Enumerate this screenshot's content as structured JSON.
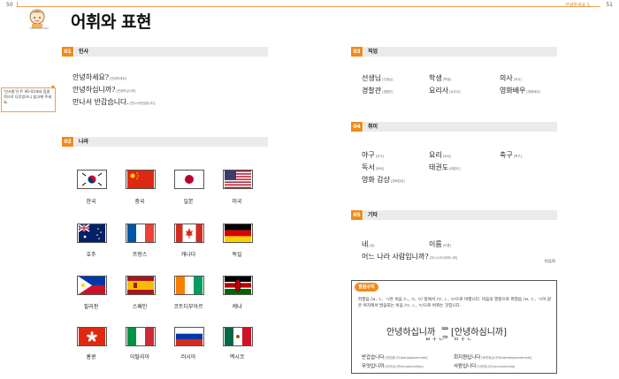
{
  "page_left": "50",
  "page_right": "51",
  "running_head": "안녕하세요 1",
  "mascot_caption": "HAN GUL SAM",
  "title": "어휘와 표현",
  "note_text": "'인사말'은 P. 40-41에서 집중적으로 다루었으니 참고해 주세요.",
  "sections": {
    "s1": {
      "num": "01",
      "label": "인사"
    },
    "s2": {
      "num": "02",
      "label": "나라"
    },
    "s3": {
      "num": "03",
      "label": "직업"
    },
    "s4": {
      "num": "04",
      "label": "취미"
    },
    "s5": {
      "num": "05",
      "label": "기타"
    }
  },
  "greetings": [
    {
      "word": "안녕하세요?",
      "gloss": "[안녕하세요]"
    },
    {
      "word": "안녕하십니까?",
      "gloss": "[안녕하심니까]"
    },
    {
      "word": "만나서 반갑습니다.",
      "gloss": "[만나서반갑씀니다]"
    }
  ],
  "countries": [
    "한국",
    "중국",
    "일본",
    "미국",
    "호주",
    "프랑스",
    "캐나다",
    "독일",
    "필리핀",
    "스페인",
    "코트디부아르",
    "케냐",
    "홍콩",
    "이탈리아",
    "러시아",
    "멕시코"
  ],
  "jobs": [
    {
      "word": "선생님",
      "gloss": "[선생님]"
    },
    {
      "word": "학생",
      "gloss": "[학쌩]"
    },
    {
      "word": "의사",
      "gloss": "[의사]"
    },
    {
      "word": "경찰관",
      "gloss": "[경찰관]"
    },
    {
      "word": "요리사",
      "gloss": "[요리사]"
    },
    {
      "word": "영화배우",
      "gloss": "[영화배우]"
    }
  ],
  "hobbies": [
    {
      "word": "야구",
      "gloss": "[야구]"
    },
    {
      "word": "요리",
      "gloss": "[요리]"
    },
    {
      "word": "축구",
      "gloss": "[축구]"
    },
    {
      "word": "독서",
      "gloss": "[독써]"
    },
    {
      "word": "태권도",
      "gloss": "[태꿘도]"
    },
    {
      "word": "영화 감상",
      "gloss": "[영화감상]"
    }
  ],
  "others": [
    {
      "word": "네",
      "gloss": "[네]"
    },
    {
      "word": "이름",
      "gloss": "[이름]"
    },
    {
      "word": "어느 나라 사람입니까?",
      "gloss": "[어느나라사라미니까]"
    }
  ],
  "byline": "비음화",
  "box": {
    "pill": "발음규칙",
    "explain": "파열음 /ㅂ, ㄷ, ㄱ/은 비음 /ㄴ, ㅁ, ㅇ/ 앞에서 /ㅁ, ㄴ, ㅇ/으로 바뀝니다. 비음의 영향으로 파열음 /ㅂ, ㄷ, ㄱ/이 같은 위치에서 발음되는 비음 /ㅁ, ㄴ, ㅇ/으로 바뀌는 것입니다.",
    "ex_left": "안녕하십니까",
    "ex_right": "[안녕하심니까]",
    "arrow": "⇒",
    "formula_left": "ㅂ ＋ ㄴ",
    "formula_right": "ㅁ ＋ ㄴ",
    "examples": [
      {
        "word": "반갑습니다",
        "gloss": "[반갑씀니다/pangapsumnida]"
      },
      {
        "word": "회지원입니다",
        "gloss": "[회지워님니다/hwedzipwonimnida]"
      },
      {
        "word": "무엇입니까",
        "gloss": "[무어심니까/muosimnikka]"
      },
      {
        "word": "사람입니다",
        "gloss": "[사라밈니다/sa:raminnida]"
      }
    ]
  },
  "colors": {
    "accent": "#f08a1c",
    "rule": "#f0a050",
    "bar": "#ebebeb"
  }
}
